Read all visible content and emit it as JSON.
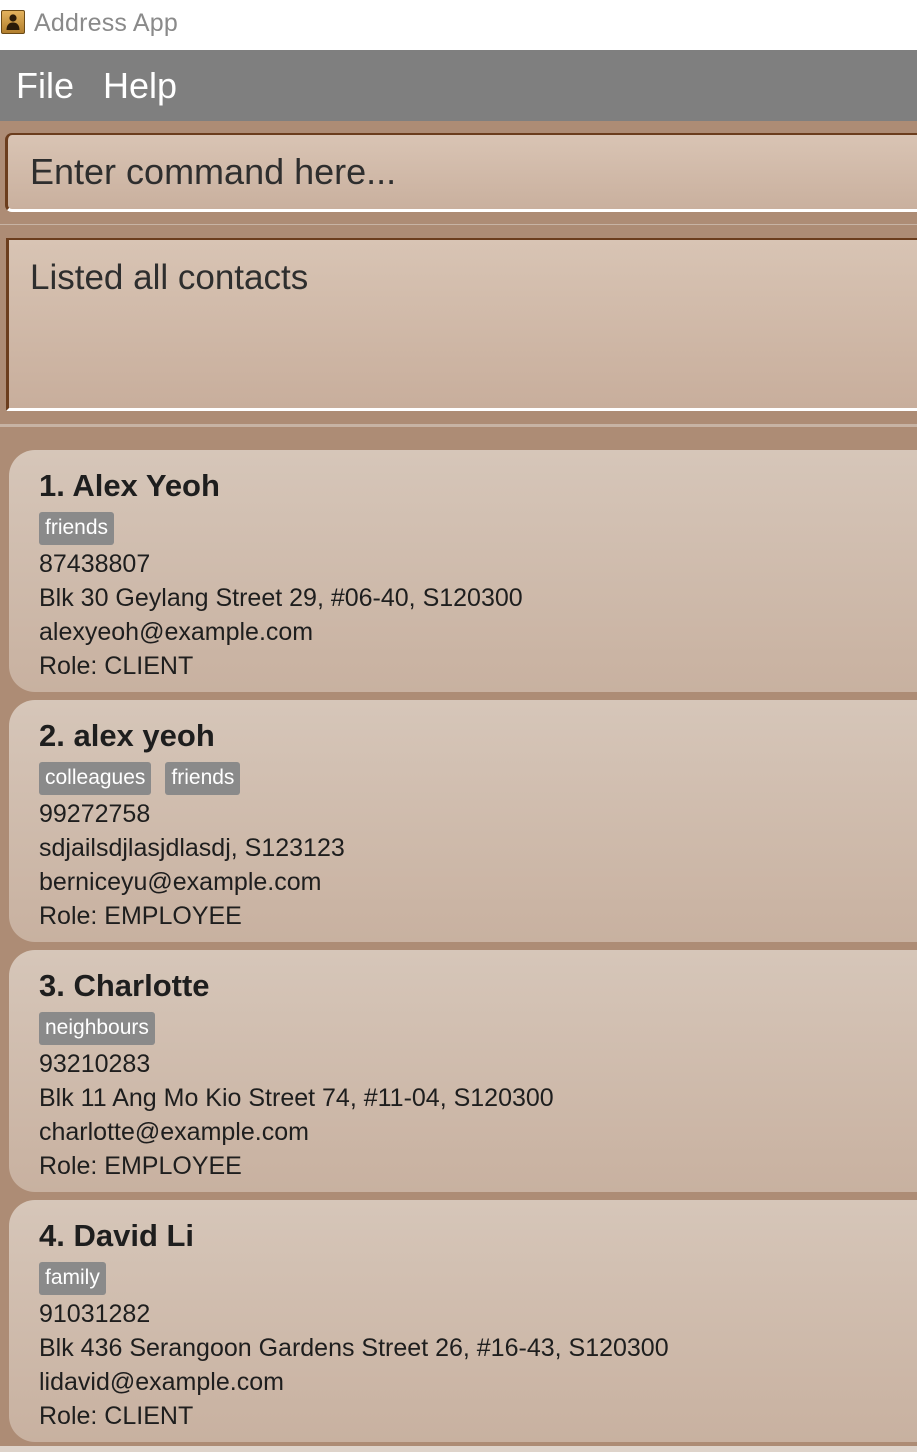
{
  "window": {
    "title": "Address App",
    "icon": "address-book-icon"
  },
  "menu": {
    "items": [
      {
        "label": "File"
      },
      {
        "label": "Help"
      }
    ]
  },
  "command": {
    "placeholder": "Enter command here...",
    "value": ""
  },
  "result": {
    "text": "Listed all contacts"
  },
  "colors": {
    "menubar": "#7f7f7f",
    "background": "#ad8c75",
    "tag": "#8a8a8a",
    "card": "#d6c6b9"
  },
  "persons": [
    {
      "name": "1. Alex Yeoh",
      "tags": [
        "friends"
      ],
      "phone": "87438807",
      "address": "Blk 30 Geylang Street 29, #06-40, S120300",
      "email": "alexyeoh@example.com",
      "role": "Role: CLIENT"
    },
    {
      "name": "2. alex yeoh",
      "tags": [
        "colleagues",
        "friends"
      ],
      "phone": "99272758",
      "address": "sdjailsdjlasjdlasdj, S123123",
      "email": "berniceyu@example.com",
      "role": "Role: EMPLOYEE"
    },
    {
      "name": "3. Charlotte",
      "tags": [
        "neighbours"
      ],
      "phone": "93210283",
      "address": "Blk 11 Ang Mo Kio Street 74, #11-04, S120300",
      "email": "charlotte@example.com",
      "role": "Role: EMPLOYEE"
    },
    {
      "name": "4. David Li",
      "tags": [
        "family"
      ],
      "phone": "91031282",
      "address": "Blk 436 Serangoon Gardens Street 26, #16-43, S120300",
      "email": "lidavid@example.com",
      "role": "Role: CLIENT"
    }
  ]
}
